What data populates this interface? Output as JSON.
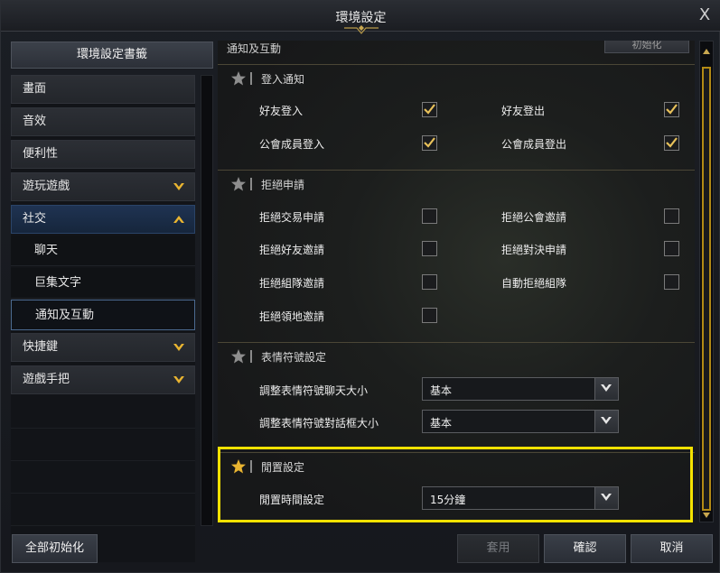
{
  "window": {
    "title": "環境設定",
    "close_label": "X"
  },
  "sidebar": {
    "bookmark_label": "環境設定書籤",
    "items": [
      {
        "label": "畫面",
        "has_chevron": false
      },
      {
        "label": "音效",
        "has_chevron": false
      },
      {
        "label": "便利性",
        "has_chevron": false
      },
      {
        "label": "遊玩遊戲",
        "has_chevron": true,
        "expanded": false
      },
      {
        "label": "社交",
        "has_chevron": true,
        "expanded": true
      },
      {
        "label": "快捷鍵",
        "has_chevron": true,
        "expanded": false
      },
      {
        "label": "遊戲手把",
        "has_chevron": true,
        "expanded": false
      }
    ],
    "subitems": [
      {
        "label": "聊天",
        "selected": false
      },
      {
        "label": "巨集文字",
        "selected": false
      },
      {
        "label": "通知及互動",
        "selected": true
      }
    ]
  },
  "content": {
    "partial_header": "通知及互動",
    "partial_button": "初始化",
    "sections": [
      {
        "title": "登入通知",
        "options": [
          {
            "label": "好友登入",
            "checked": true
          },
          {
            "label": "好友登出",
            "checked": true
          },
          {
            "label": "公會成員登入",
            "checked": true
          },
          {
            "label": "公會成員登出",
            "checked": true
          }
        ]
      },
      {
        "title": "拒絕申請",
        "options": [
          {
            "label": "拒絕交易申請",
            "checked": false
          },
          {
            "label": "拒絕公會邀請",
            "checked": false
          },
          {
            "label": "拒絕好友邀請",
            "checked": false
          },
          {
            "label": "拒絕對決申請",
            "checked": false
          },
          {
            "label": "拒絕組隊邀請",
            "checked": false
          },
          {
            "label": "自動拒絕組隊",
            "checked": false
          },
          {
            "label": "拒絕領地邀請",
            "checked": false
          }
        ]
      },
      {
        "title": "表情符號設定",
        "dropdowns": [
          {
            "label": "調整表情符號聊天大小",
            "value": "基本"
          },
          {
            "label": "調整表情符號對話框大小",
            "value": "基本"
          }
        ]
      },
      {
        "title": "閒置設定",
        "highlighted": true,
        "dropdowns": [
          {
            "label": "閒置時間設定",
            "value": "15分鐘"
          }
        ]
      }
    ]
  },
  "footer": {
    "reset_all_label": "全部初始化",
    "apply_label": "套用",
    "confirm_label": "確認",
    "cancel_label": "取消"
  },
  "colors": {
    "check": "#e8c15a",
    "highlight": "#f4e200",
    "star_active": "#e8b431",
    "star_inactive": "#8e8e8e"
  }
}
